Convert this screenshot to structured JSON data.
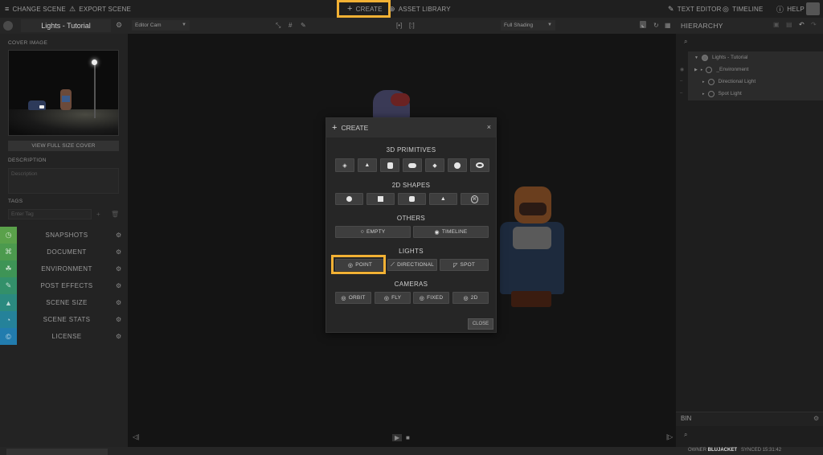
{
  "topbar": {
    "change_scene": "CHANGE SCENE",
    "export_scene": "EXPORT SCENE",
    "create": "CREATE",
    "asset_library": "ASSET LIBRARY",
    "text_editor": "TEXT EDITOR",
    "timeline": "TIMELINE",
    "help": "HELP"
  },
  "left_panel": {
    "title": "Lights - Tutorial",
    "cover_label": "COVER IMAGE",
    "view_full_label": "VIEW FULL SIZE COVER",
    "description_label": "DESCRIPTION",
    "description_placeholder": "Description",
    "tags_label": "TAGS",
    "tags_placeholder": "Enter Tag",
    "sections": [
      {
        "label": "SNAPSHOTS",
        "color": "#5aa14a"
      },
      {
        "label": "DOCUMENT",
        "color": "#4c9a4e"
      },
      {
        "label": "ENVIRONMENT",
        "color": "#3e9456"
      },
      {
        "label": "POST EFFECTS",
        "color": "#33906a"
      },
      {
        "label": "SCENE SIZE",
        "color": "#2b8a80"
      },
      {
        "label": "SCENE STATS",
        "color": "#25829a"
      },
      {
        "label": "LICENSE",
        "color": "#227cae"
      }
    ]
  },
  "viewport": {
    "camera_select": "Editor Cam",
    "shading_select": "Full Shading"
  },
  "right_panel": {
    "hierarchy_title": "HIERARCHY",
    "tree": [
      {
        "label": "Lights - Tutorial"
      },
      {
        "label": "_Environment"
      },
      {
        "label": "Directional Light"
      },
      {
        "label": "Spot Light"
      }
    ],
    "bin_title": "BIN"
  },
  "statusbar": {
    "owner_label": "OWNER",
    "owner_value": "BLUJACKET",
    "synced_label": "SYNCED",
    "synced_time": "15:31:42"
  },
  "modal": {
    "title": "CREATE",
    "close_x": "×",
    "categories": {
      "primitives": "3D PRIMITIVES",
      "shapes2d": "2D SHAPES",
      "others": "OTHERS",
      "lights": "LIGHTS",
      "cameras": "CAMERAS"
    },
    "others": {
      "empty": "EMPTY",
      "timeline": "TIMELINE"
    },
    "lights": {
      "point": "POINT",
      "directional": "DIRECTIONAL",
      "spot": "SPOT"
    },
    "cameras": {
      "orbit": "ORBIT",
      "fly": "FLY",
      "fixed": "FIXED",
      "two_d": "2D"
    },
    "close_button": "CLOSE"
  }
}
